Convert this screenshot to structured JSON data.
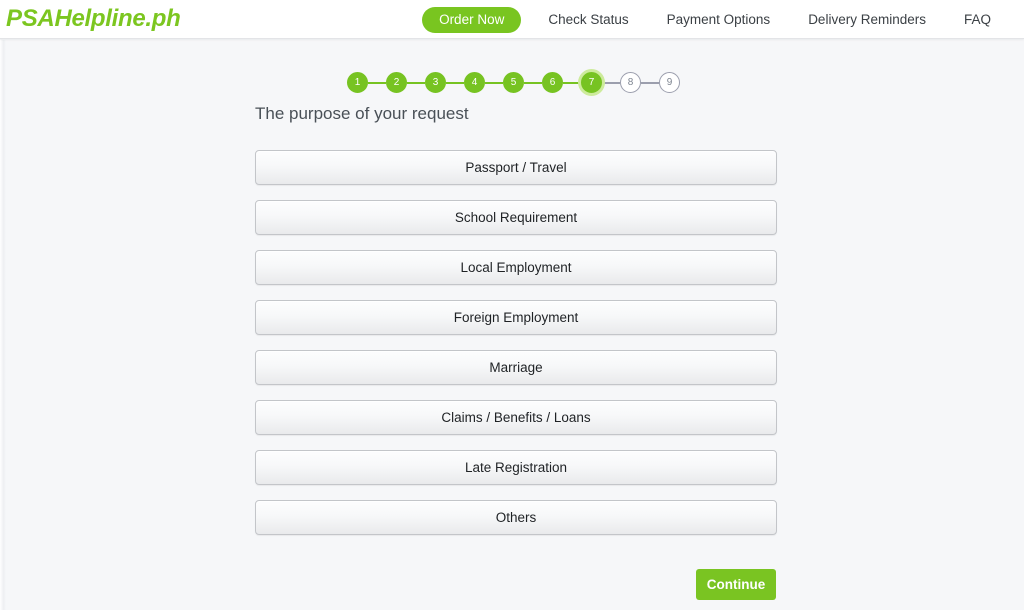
{
  "header": {
    "logo": "PSAHelpline.ph",
    "nav": [
      {
        "label": "Order Now",
        "active": true
      },
      {
        "label": "Check Status",
        "active": false
      },
      {
        "label": "Payment Options",
        "active": false
      },
      {
        "label": "Delivery Reminders",
        "active": false
      },
      {
        "label": "FAQ",
        "active": false
      }
    ]
  },
  "stepper": {
    "current_step": 7,
    "total_steps": 9,
    "steps": [
      {
        "number": "1",
        "state": "done"
      },
      {
        "number": "2",
        "state": "done"
      },
      {
        "number": "3",
        "state": "done"
      },
      {
        "number": "4",
        "state": "done"
      },
      {
        "number": "5",
        "state": "done"
      },
      {
        "number": "6",
        "state": "done"
      },
      {
        "number": "7",
        "state": "current"
      },
      {
        "number": "8",
        "state": "todo"
      },
      {
        "number": "9",
        "state": "todo"
      }
    ]
  },
  "main": {
    "title": "The purpose of your request",
    "options": [
      {
        "label": "Passport / Travel"
      },
      {
        "label": "School Requirement"
      },
      {
        "label": "Local Employment"
      },
      {
        "label": "Foreign Employment"
      },
      {
        "label": "Marriage"
      },
      {
        "label": "Claims / Benefits / Loans"
      },
      {
        "label": "Late Registration"
      },
      {
        "label": "Others"
      }
    ],
    "continue_label": "Continue"
  },
  "colors": {
    "brand_green": "#7ac422",
    "step_done": "#77c322",
    "step_ring": "#cdeb9c",
    "step_todo_border": "#9b9ead",
    "page_background": "#f6f7f9",
    "header_background": "#ffffff",
    "nav_text": "#3b4045",
    "title_text": "#495057"
  }
}
